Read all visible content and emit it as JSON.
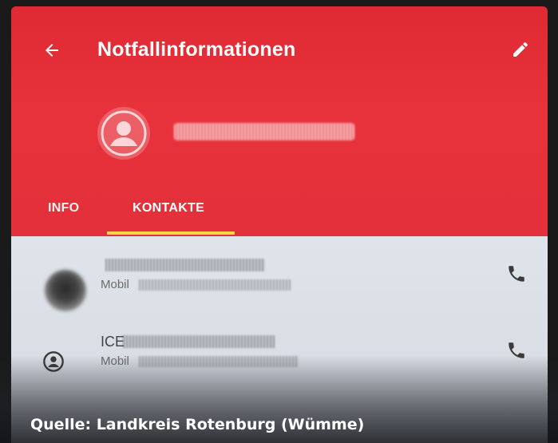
{
  "app_bar": {
    "title": "Notfallinformationen",
    "back_icon": "arrow-left-icon",
    "edit_icon": "pencil-icon",
    "color": "#e4303a"
  },
  "tabs": [
    {
      "label": "INFO",
      "selected": false
    },
    {
      "label": "KONTAKTE",
      "selected": true
    }
  ],
  "tab_indicator_color": "#f7d54a",
  "contacts": [
    {
      "name": "",
      "subtitle": "Mobil",
      "avatar": "photo",
      "action_icon": "phone-icon"
    },
    {
      "name": "ICE",
      "subtitle": "Mobil",
      "avatar": "person-circle-icon",
      "action_icon": "phone-icon"
    }
  ],
  "caption": "Quelle: Landkreis Rotenburg (Wümme)"
}
